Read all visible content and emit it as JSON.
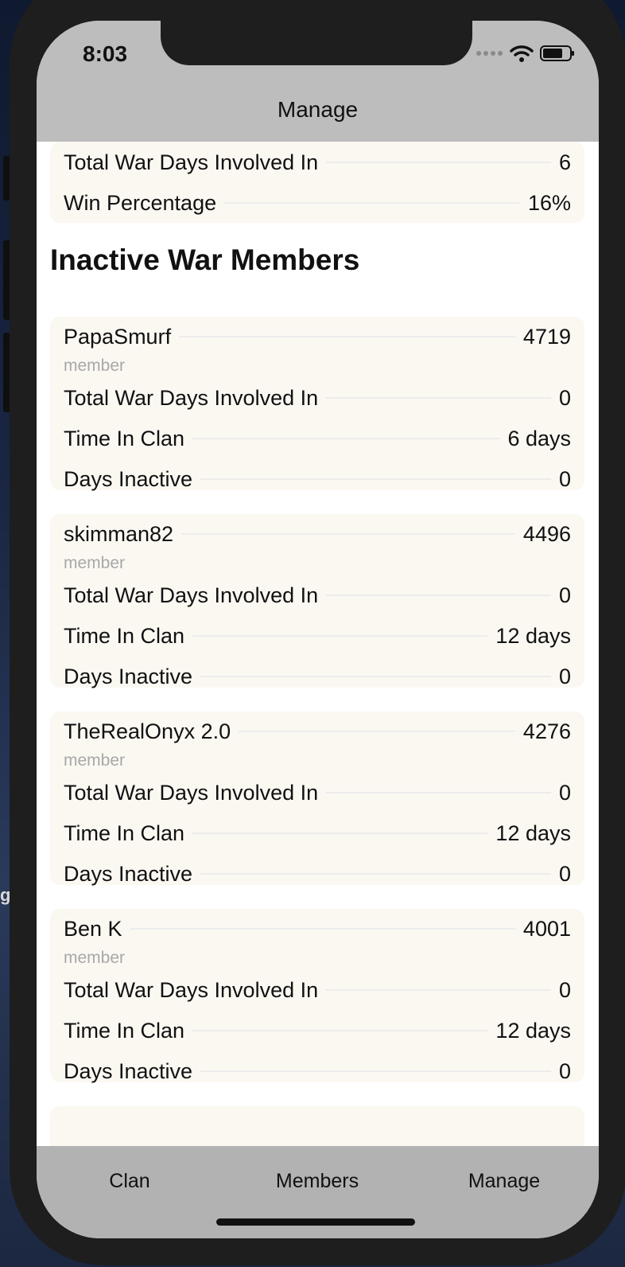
{
  "status_bar": {
    "time": "8:03"
  },
  "nav": {
    "title": "Manage"
  },
  "summary": {
    "rows": [
      {
        "label": "Total War Days Involved In",
        "value": "6"
      },
      {
        "label": "Win Percentage",
        "value": "16%"
      }
    ]
  },
  "section": {
    "title": "Inactive War Members"
  },
  "members": [
    {
      "name": "PapaSmurf",
      "trophies": "4719",
      "role": "member",
      "rows": [
        {
          "label": "Total War Days Involved In",
          "value": "0"
        },
        {
          "label": "Time In Clan",
          "value": "6 days"
        },
        {
          "label": "Days Inactive",
          "value": "0"
        }
      ]
    },
    {
      "name": "skimman82",
      "trophies": "4496",
      "role": "member",
      "rows": [
        {
          "label": "Total War Days Involved In",
          "value": "0"
        },
        {
          "label": "Time In Clan",
          "value": "12 days"
        },
        {
          "label": "Days Inactive",
          "value": "0"
        }
      ]
    },
    {
      "name": "TheRealOnyx 2.0",
      "trophies": "4276",
      "role": "member",
      "rows": [
        {
          "label": "Total War Days Involved In",
          "value": "0"
        },
        {
          "label": "Time In Clan",
          "value": "12 days"
        },
        {
          "label": "Days Inactive",
          "value": "0"
        }
      ]
    },
    {
      "name": "Ben K",
      "trophies": "4001",
      "role": "member",
      "rows": [
        {
          "label": "Total War Days Involved In",
          "value": "0"
        },
        {
          "label": "Time In Clan",
          "value": "12 days"
        },
        {
          "label": "Days Inactive",
          "value": "0"
        }
      ]
    }
  ],
  "tabbar": {
    "items": [
      "Clan",
      "Members",
      "Manage"
    ]
  },
  "icons": {
    "signal": "signal-dots-icon",
    "wifi": "wifi-icon",
    "battery": "battery-icon"
  },
  "colors": {
    "navbar": "#bdbdbd",
    "tabbar": "#b2b2b2",
    "card": "#fbf8f2",
    "role": "#a8a8a8"
  }
}
